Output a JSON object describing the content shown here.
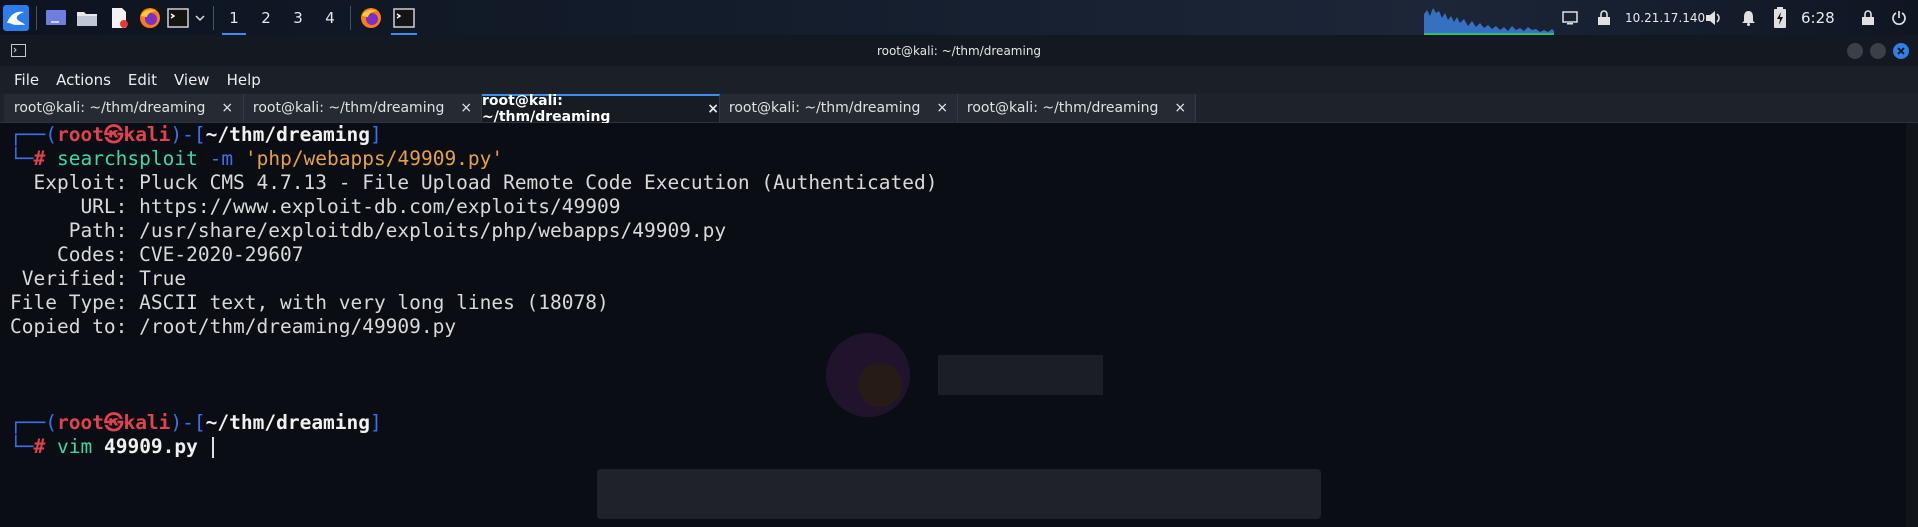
{
  "panel": {
    "workspaces": [
      "1",
      "2",
      "3",
      "4"
    ],
    "active_workspace": "1",
    "ip_address": "10.21.17.140",
    "clock": "6:28",
    "icons": [
      "kali-menu-icon",
      "desktop-icon",
      "file-manager-icon",
      "text-editor-icon",
      "firefox-icon",
      "terminal-icon",
      "chevron-down-icon",
      "firefox-task-icon",
      "terminal-task-icon",
      "cpu-graph-icon",
      "screen-icon",
      "vpn-lock-icon",
      "volume-icon",
      "notification-bell-icon",
      "battery-icon",
      "lock-screen-icon",
      "power-icon"
    ]
  },
  "window": {
    "title": "root@kali: ~/thm/dreaming"
  },
  "menu": [
    "File",
    "Actions",
    "Edit",
    "View",
    "Help"
  ],
  "tabs": [
    {
      "label": "root@kali: ~/thm/dreaming",
      "close": "×"
    },
    {
      "label": "root@kali: ~/thm/dreaming",
      "close": "×"
    },
    {
      "label": "root@kali: ~/thm/dreaming",
      "close": "×"
    },
    {
      "label": "root@kali: ~/thm/dreaming",
      "close": "×"
    },
    {
      "label": "root@kali: ~/thm/dreaming",
      "close": "×"
    }
  ],
  "active_tab": 2,
  "terminal": {
    "prompt1": {
      "open": "┌──(",
      "user": "root",
      "at": "㉿",
      "host": "kali",
      "mid": ")-[",
      "path": "~/thm/dreaming",
      "close": "]"
    },
    "cmd1": {
      "prefix": "└─",
      "hash": "#",
      "name": "searchsploit",
      "flag": "-m",
      "arg": "'php/webapps/49909.py'"
    },
    "output": [
      "  Exploit: Pluck CMS 4.7.13 - File Upload Remote Code Execution (Authenticated)",
      "      URL: https://www.exploit-db.com/exploits/49909",
      "     Path: /usr/share/exploitdb/exploits/php/webapps/49909.py",
      "    Codes: CVE-2020-29607",
      " Verified: True",
      "File Type: ASCII text, with very long lines (18078)",
      "Copied to: /root/thm/dreaming/49909.py"
    ],
    "prompt2": {
      "open": "┌──(",
      "user": "root",
      "at": "㉿",
      "host": "kali",
      "mid": ")-[",
      "path": "~/thm/dreaming",
      "close": "]"
    },
    "cmd2": {
      "prefix": "└─",
      "hash": "#",
      "name": "vim",
      "arg": "49909.py"
    }
  },
  "colors": {
    "accent": "#3b8ef0",
    "prompt_red": "#e0434f",
    "prompt_blue": "#3e70e8",
    "command_green": "#3fd7a7",
    "string_orange": "#e6a145"
  }
}
